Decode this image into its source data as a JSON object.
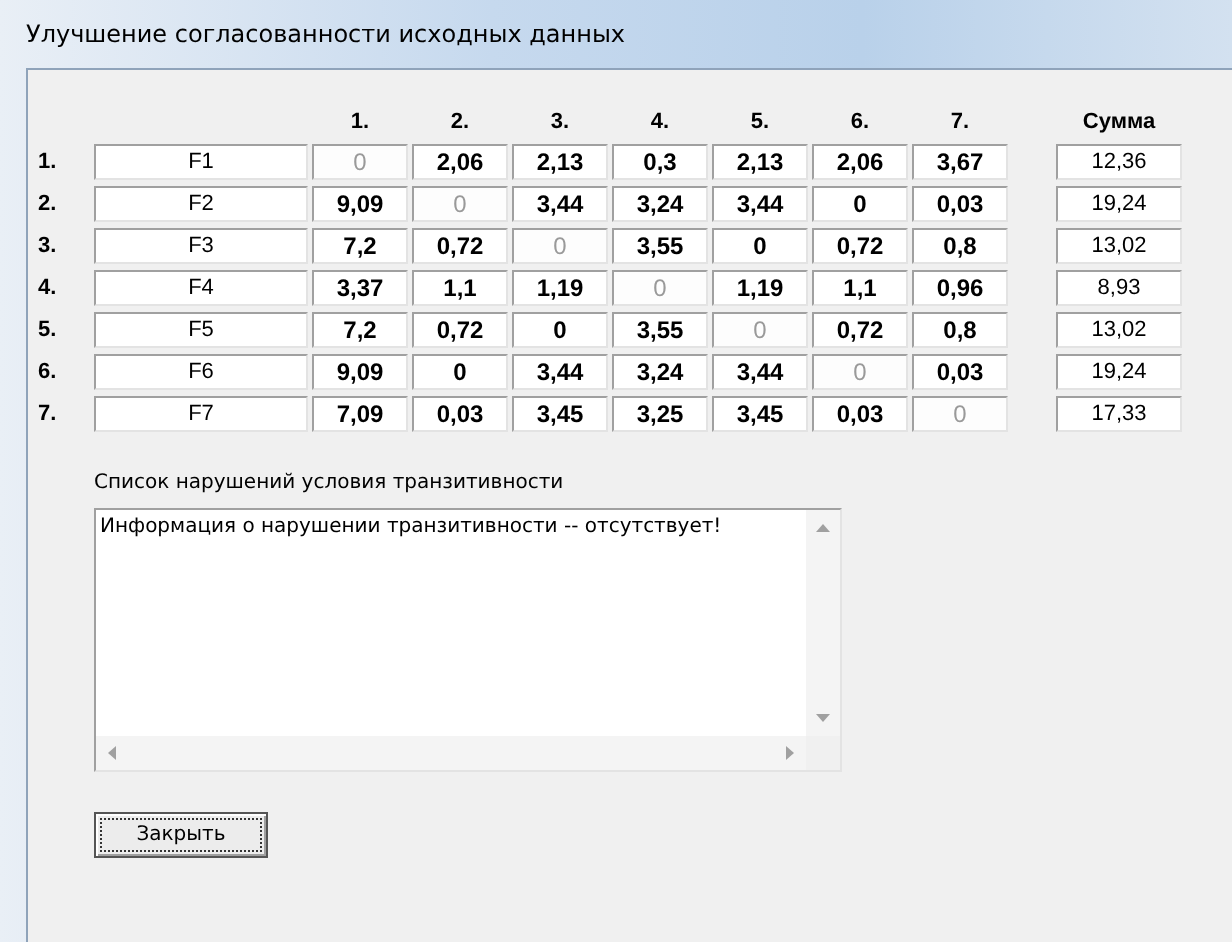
{
  "window": {
    "title": "Улучшение согласованности исходных данных"
  },
  "table": {
    "columns": [
      "1.",
      "2.",
      "3.",
      "4.",
      "5.",
      "6.",
      "7."
    ],
    "sum_header": "Сумма",
    "rows": [
      {
        "number": "1.",
        "name": "F1",
        "cells": [
          {
            "value": "0",
            "disabled": true
          },
          {
            "value": "2,06",
            "disabled": false
          },
          {
            "value": "2,13",
            "disabled": false
          },
          {
            "value": "0,3",
            "disabled": false
          },
          {
            "value": "2,13",
            "disabled": false
          },
          {
            "value": "2,06",
            "disabled": false
          },
          {
            "value": "3,67",
            "disabled": false
          }
        ],
        "sum": "12,36"
      },
      {
        "number": "2.",
        "name": "F2",
        "cells": [
          {
            "value": "9,09",
            "disabled": false
          },
          {
            "value": "0",
            "disabled": true
          },
          {
            "value": "3,44",
            "disabled": false
          },
          {
            "value": "3,24",
            "disabled": false
          },
          {
            "value": "3,44",
            "disabled": false
          },
          {
            "value": "0",
            "disabled": false
          },
          {
            "value": "0,03",
            "disabled": false
          }
        ],
        "sum": "19,24"
      },
      {
        "number": "3.",
        "name": "F3",
        "cells": [
          {
            "value": "7,2",
            "disabled": false
          },
          {
            "value": "0,72",
            "disabled": false
          },
          {
            "value": "0",
            "disabled": true
          },
          {
            "value": "3,55",
            "disabled": false
          },
          {
            "value": "0",
            "disabled": false
          },
          {
            "value": "0,72",
            "disabled": false
          },
          {
            "value": "0,8",
            "disabled": false
          }
        ],
        "sum": "13,02"
      },
      {
        "number": "4.",
        "name": "F4",
        "cells": [
          {
            "value": "3,37",
            "disabled": false
          },
          {
            "value": "1,1",
            "disabled": false
          },
          {
            "value": "1,19",
            "disabled": false
          },
          {
            "value": "0",
            "disabled": true
          },
          {
            "value": "1,19",
            "disabled": false
          },
          {
            "value": "1,1",
            "disabled": false
          },
          {
            "value": "0,96",
            "disabled": false
          }
        ],
        "sum": "8,93"
      },
      {
        "number": "5.",
        "name": "F5",
        "cells": [
          {
            "value": "7,2",
            "disabled": false
          },
          {
            "value": "0,72",
            "disabled": false
          },
          {
            "value": "0",
            "disabled": false
          },
          {
            "value": "3,55",
            "disabled": false
          },
          {
            "value": "0",
            "disabled": true
          },
          {
            "value": "0,72",
            "disabled": false
          },
          {
            "value": "0,8",
            "disabled": false
          }
        ],
        "sum": "13,02"
      },
      {
        "number": "6.",
        "name": "F6",
        "cells": [
          {
            "value": "9,09",
            "disabled": false
          },
          {
            "value": "0",
            "disabled": false
          },
          {
            "value": "3,44",
            "disabled": false
          },
          {
            "value": "3,24",
            "disabled": false
          },
          {
            "value": "3,44",
            "disabled": false
          },
          {
            "value": "0",
            "disabled": true
          },
          {
            "value": "0,03",
            "disabled": false
          }
        ],
        "sum": "19,24"
      },
      {
        "number": "7.",
        "name": "F7",
        "cells": [
          {
            "value": "7,09",
            "disabled": false
          },
          {
            "value": "0,03",
            "disabled": false
          },
          {
            "value": "3,45",
            "disabled": false
          },
          {
            "value": "3,25",
            "disabled": false
          },
          {
            "value": "3,45",
            "disabled": false
          },
          {
            "value": "0,03",
            "disabled": false
          },
          {
            "value": "0",
            "disabled": true
          }
        ],
        "sum": "17,33"
      }
    ]
  },
  "violations": {
    "label": "Список нарушений условия транзитивности",
    "text": "Информация о нарушении транзитивности -- отсутствует!"
  },
  "buttons": [
    "Закрыть"
  ]
}
